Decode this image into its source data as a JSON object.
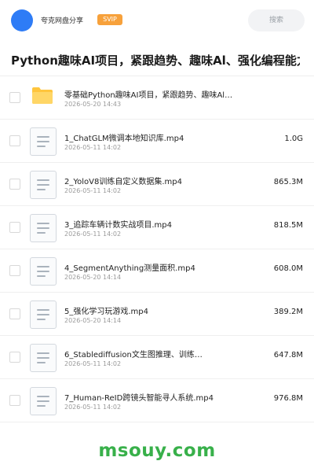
{
  "header": {
    "uploader": "夸克网盘分享",
    "badge": "SVIP",
    "search_label": "搜索"
  },
  "share_title": "Python趣味AI项目，紧跟趋势、趣味Al、强化编程能力",
  "files": [
    {
      "type": "folder",
      "name": "零基础Python趣味AI项目，紧跟趋势、趣味Al…",
      "date": "2026-05-20 14:43",
      "size": ""
    },
    {
      "type": "file",
      "name": "1_ChatGLM微调本地知识库.mp4",
      "date": "2026-05-11 14:02",
      "size": "1.0G"
    },
    {
      "type": "file",
      "name": "2_YoloV8训练自定义数据集.mp4",
      "date": "2026-05-11 14:02",
      "size": "865.3M"
    },
    {
      "type": "file",
      "name": "3_追踪车辆计数实战项目.mp4",
      "date": "2026-05-11 14:02",
      "size": "818.5M"
    },
    {
      "type": "file",
      "name": "4_SegmentAnything测量面积.mp4",
      "date": "2026-05-20 14:14",
      "size": "608.0M"
    },
    {
      "type": "file",
      "name": "5_强化学习玩游戏.mp4",
      "date": "2026-05-20 14:14",
      "size": "389.2M"
    },
    {
      "type": "file",
      "name": "6_Stablediffusion文生图推理、训练…",
      "date": "2026-05-11 14:02",
      "size": "647.8M"
    },
    {
      "type": "file",
      "name": "7_Human-ReID跨镜头智能寻人系统.mp4",
      "date": "2026-05-11 14:02",
      "size": "976.8M"
    }
  ],
  "watermark": "msouy.com",
  "colors": {
    "accent": "#2e7cf6",
    "svip": "#f7a13b",
    "folder": "#ffc53d",
    "watermark": "#38b04a"
  }
}
